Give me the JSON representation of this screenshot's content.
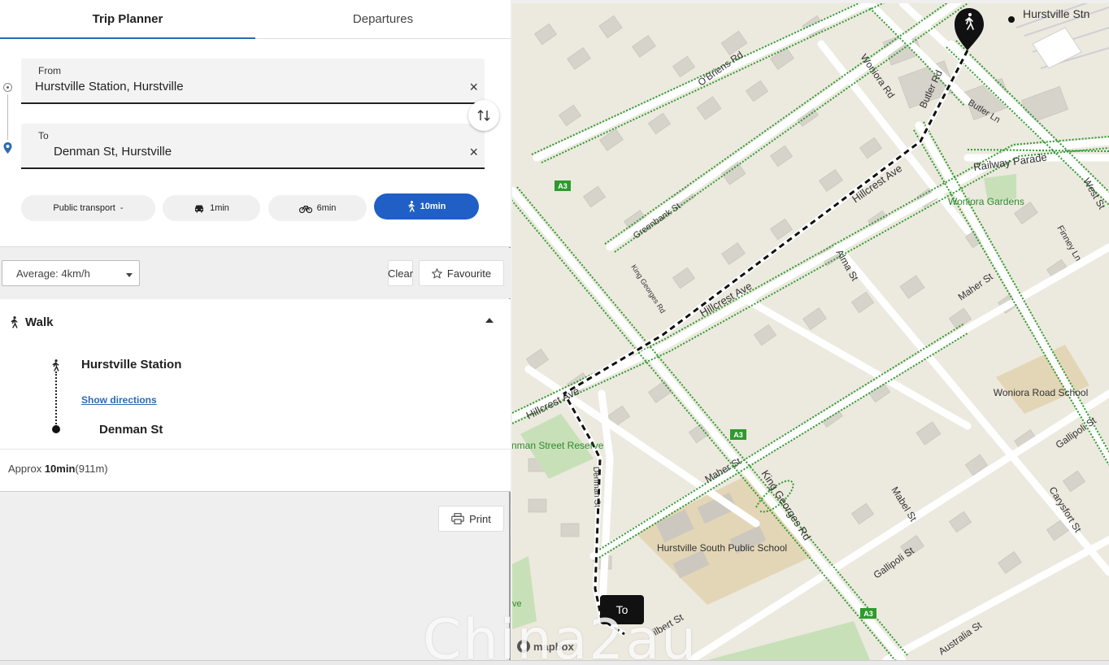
{
  "tabs": [
    {
      "label": "Trip Planner",
      "active": true
    },
    {
      "label": "Departures",
      "active": false
    }
  ],
  "from": {
    "label": "From",
    "value": "Hurstville Station, Hurstville"
  },
  "to": {
    "label": "To",
    "value": "Denman St, Hurstville"
  },
  "clear_glyph": "×",
  "modes": {
    "public_transport": "Public transport  -",
    "car": "1min",
    "bike": "6min",
    "walk": "10min"
  },
  "options": {
    "speed": "Average: 4km/h",
    "clear": "Clear",
    "favourite": "Favourite"
  },
  "result": {
    "leg_title": "Walk",
    "start_stop": "Hurstville Station",
    "directions_link": "Show directions",
    "end_stop": "Denman St",
    "approx_prefix": "Approx",
    "duration": "10min",
    "distance": "(911m)"
  },
  "print_label": "Print",
  "map": {
    "labels": {
      "hurstville_stn": "Hurstville Stn",
      "obrien": "O'Briens Rd",
      "woniora_rd": "Woniora Rd",
      "butler_rd": "Butler Rd",
      "butler_ln": "Butler Ln",
      "railway_parade": "Railway Parade",
      "woniora_gardens": "Woniora Gardens",
      "west_st": "West St",
      "finney_ln": "Finney Ln",
      "greenbank": "Greenbank St",
      "hillcrest_top": "Hillcrest Ave",
      "hillcrest_mid": "Hillcrest Ave",
      "hillcrest_low": "Hillcrest Ave",
      "alma": "Alma St",
      "maher_top": "Maher St",
      "maher_low": "Maher St",
      "king_georges_small": "King Georges Rd",
      "king_georges": "King Georges Rd",
      "woniora_school": "Woniora Road School",
      "denman_reserve": "Denman Street Reserve",
      "denman_st": "Denman St",
      "hurstville_south": "Hurstville South Public School",
      "mabel": "Mabel St",
      "gallipoli_top": "Gallipoli St",
      "gallipoli_low": "Gallipoli St",
      "carysfort": "Carysfort St",
      "australia": "Australia St",
      "gilbert": "ilbert St",
      "edge_ve": "ve",
      "a3": "A3",
      "to_marker": "To",
      "mapbox": "mapbox"
    }
  },
  "watermark": "China2au"
}
